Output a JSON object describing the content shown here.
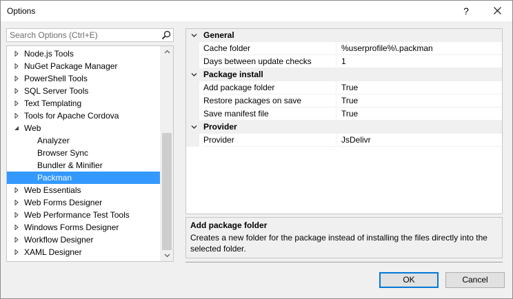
{
  "window": {
    "title": "Options",
    "help_label": "?"
  },
  "search": {
    "placeholder": "Search Options (Ctrl+E)"
  },
  "tree": {
    "items": [
      {
        "label": "Node.js Tools",
        "expandable": true
      },
      {
        "label": "NuGet Package Manager",
        "expandable": true
      },
      {
        "label": "PowerShell Tools",
        "expandable": true
      },
      {
        "label": "SQL Server Tools",
        "expandable": true
      },
      {
        "label": "Text Templating",
        "expandable": true
      },
      {
        "label": "Tools for Apache Cordova",
        "expandable": true
      },
      {
        "label": "Web",
        "expanded": true
      },
      {
        "label": "Analyzer",
        "child": true
      },
      {
        "label": "Browser Sync",
        "child": true
      },
      {
        "label": "Bundler & Minifier",
        "child": true
      },
      {
        "label": "Packman",
        "child": true,
        "selected": true
      },
      {
        "label": "Web Essentials",
        "expandable": true
      },
      {
        "label": "Web Forms Designer",
        "expandable": true
      },
      {
        "label": "Web Performance Test Tools",
        "expandable": true
      },
      {
        "label": "Windows Forms Designer",
        "expandable": true
      },
      {
        "label": "Workflow Designer",
        "expandable": true
      },
      {
        "label": "XAML Designer",
        "expandable": true
      }
    ]
  },
  "properties": {
    "categories": [
      {
        "label": "General",
        "rows": [
          {
            "name": "Cache folder",
            "value": "%userprofile%\\.packman"
          },
          {
            "name": "Days between update checks",
            "value": "1"
          }
        ]
      },
      {
        "label": "Package install",
        "rows": [
          {
            "name": "Add package folder",
            "value": "True"
          },
          {
            "name": "Restore packages on save",
            "value": "True"
          },
          {
            "name": "Save manifest file",
            "value": "True"
          }
        ]
      },
      {
        "label": "Provider",
        "rows": [
          {
            "name": "Provider",
            "value": "JsDelivr"
          }
        ]
      }
    ]
  },
  "description": {
    "title": "Add package folder",
    "text": "Creates a new folder for the package instead of installing the files directly into the selected folder."
  },
  "buttons": {
    "ok": "OK",
    "cancel": "Cancel"
  },
  "colors": {
    "selection": "#3399ff",
    "default_button_border": "#0078d7"
  }
}
